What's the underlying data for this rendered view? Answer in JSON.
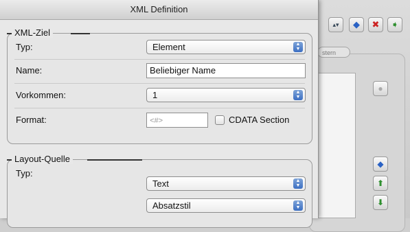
{
  "dialog": {
    "title": "XML Definition"
  },
  "xml_target": {
    "title": "XML-Ziel",
    "type_label": "Typ:",
    "type_value": "Element",
    "name_label": "Name:",
    "name_value": "Beliebiger Name",
    "occurrence_label": "Vorkommen:",
    "occurrence_value": "1",
    "format_label": "Format:",
    "format_placeholder": "<#>",
    "cdata_label": "CDATA Section"
  },
  "layout_source": {
    "title": "Layout-Quelle",
    "type_label": "Typ:",
    "type_value": "Text",
    "style_value": "Absatzstil"
  },
  "background_window": {
    "tab_label": "stern"
  },
  "colors": {
    "accent": "#3c6fc3",
    "remove": "#cc2222",
    "move": "#2f8f2f"
  }
}
